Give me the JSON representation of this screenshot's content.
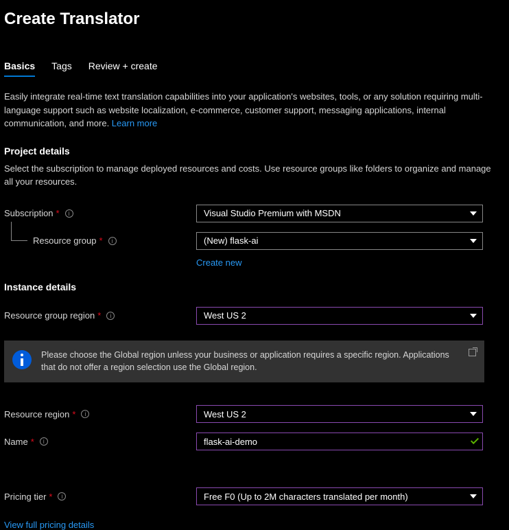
{
  "pageTitle": "Create Translator",
  "tabs": {
    "basics": "Basics",
    "tags": "Tags",
    "review": "Review + create"
  },
  "intro": {
    "text": "Easily integrate real-time text translation capabilities into your application's websites, tools, or any solution requiring multi-language support such as website localization, e-commerce, customer support, messaging applications, internal communication, and more. ",
    "learnMore": "Learn more"
  },
  "projectDetails": {
    "heading": "Project details",
    "description": "Select the subscription to manage deployed resources and costs. Use resource groups like folders to organize and manage all your resources."
  },
  "fields": {
    "subscription": {
      "label": "Subscription",
      "value": "Visual Studio Premium with MSDN"
    },
    "resourceGroup": {
      "label": "Resource group",
      "value": "(New) flask-ai",
      "createNew": "Create new"
    },
    "resourceGroupRegion": {
      "label": "Resource group region",
      "value": "West US 2"
    },
    "resourceRegion": {
      "label": "Resource region",
      "value": "West US 2"
    },
    "name": {
      "label": "Name",
      "value": "flask-ai-demo"
    },
    "pricingTier": {
      "label": "Pricing tier",
      "value": "Free F0 (Up to 2M characters translated per month)"
    }
  },
  "instanceDetails": {
    "heading": "Instance details"
  },
  "infoBanner": {
    "text": "Please choose the Global region unless your business or application requires a specific region. Applications that do not offer a region selection use the Global region."
  },
  "pricingLink": "View full pricing details"
}
